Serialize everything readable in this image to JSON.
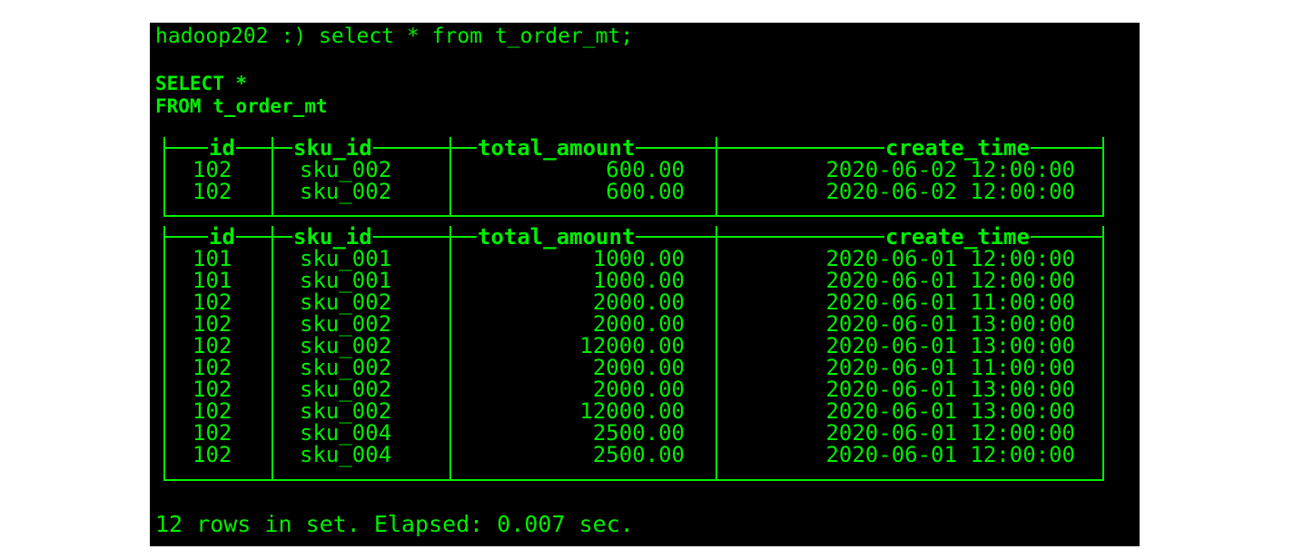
{
  "terminal": {
    "prompt_line": "hadoop202 :) select * from t_order_mt;",
    "formatted_query": [
      "SELECT *",
      "FROM t_order_mt"
    ],
    "footer": "12 rows in set. Elapsed: 0.007 sec."
  },
  "columns": [
    "id",
    "sku_id",
    "total_amount",
    "create_time"
  ],
  "tables": [
    {
      "rows": [
        [
          "102",
          "sku_002",
          "600.00",
          "2020-06-02 12:00:00"
        ],
        [
          "102",
          "sku_002",
          "600.00",
          "2020-06-02 12:00:00"
        ]
      ]
    },
    {
      "rows": [
        [
          "101",
          "sku_001",
          "1000.00",
          "2020-06-01 12:00:00"
        ],
        [
          "101",
          "sku_001",
          "1000.00",
          "2020-06-01 12:00:00"
        ],
        [
          "102",
          "sku_002",
          "2000.00",
          "2020-06-01 11:00:00"
        ],
        [
          "102",
          "sku_002",
          "2000.00",
          "2020-06-01 13:00:00"
        ],
        [
          "102",
          "sku_002",
          "12000.00",
          "2020-06-01 13:00:00"
        ],
        [
          "102",
          "sku_002",
          "2000.00",
          "2020-06-01 11:00:00"
        ],
        [
          "102",
          "sku_002",
          "2000.00",
          "2020-06-01 13:00:00"
        ],
        [
          "102",
          "sku_002",
          "12000.00",
          "2020-06-01 13:00:00"
        ],
        [
          "102",
          "sku_004",
          "2500.00",
          "2020-06-01 12:00:00"
        ],
        [
          "102",
          "sku_004",
          "2500.00",
          "2020-06-01 12:00:00"
        ]
      ]
    }
  ],
  "colors": {
    "background": "#000000",
    "text": "#00ee00"
  }
}
